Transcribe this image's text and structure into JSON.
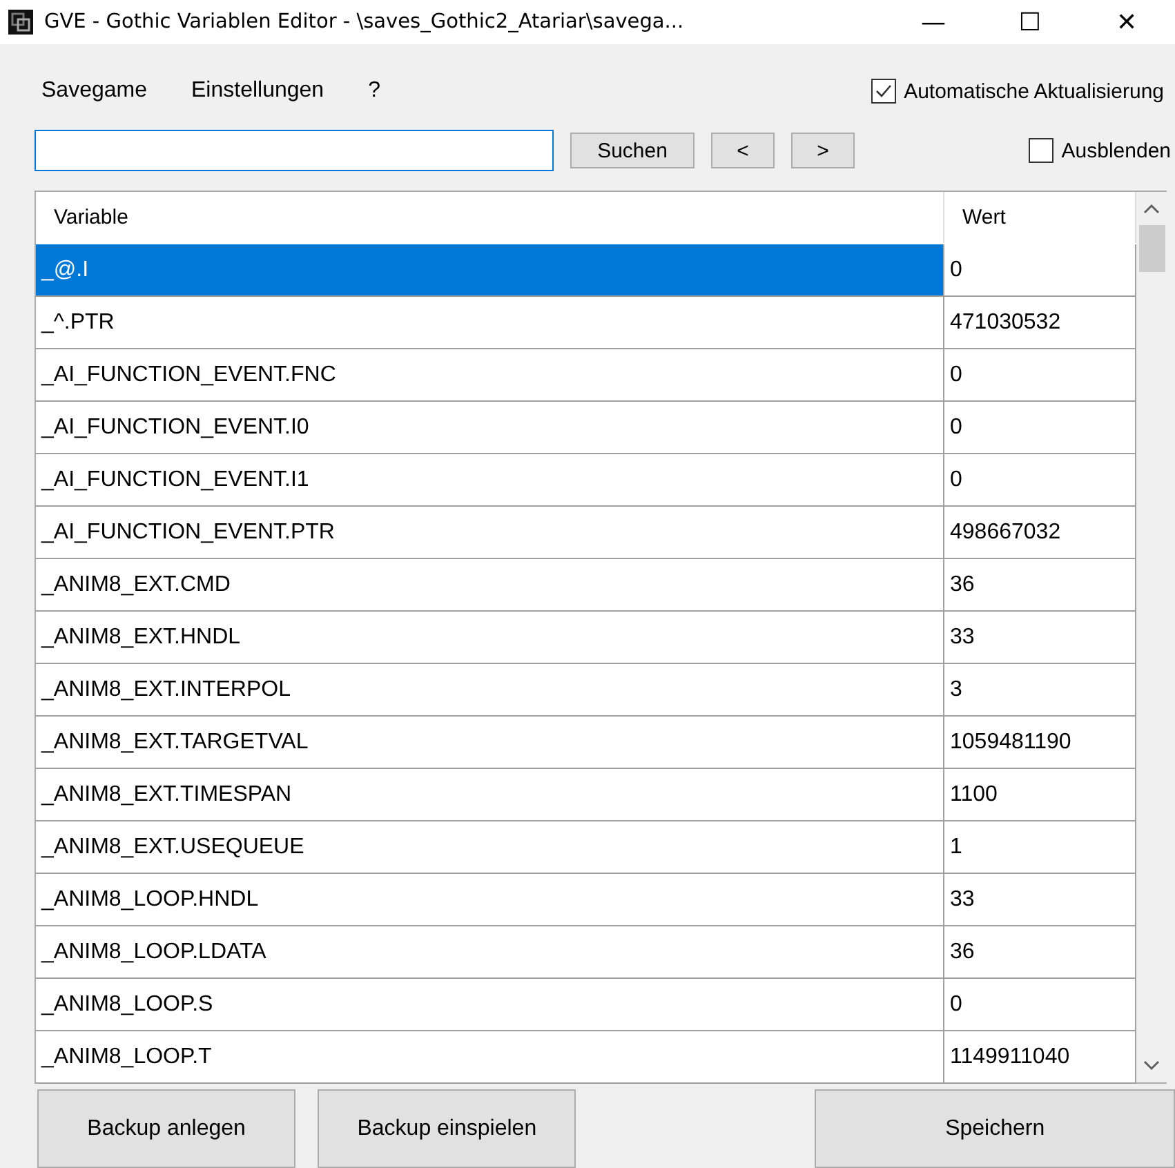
{
  "window": {
    "title": "GVE - Gothic Variablen Editor - \\saves_Gothic2_Atariar\\savega...",
    "controls": [
      "—",
      "☐",
      "✕"
    ]
  },
  "menu": [
    "Savegame",
    "Einstellungen",
    "?"
  ],
  "auto_update": {
    "label": "Automatische Aktualisierung",
    "checked": true
  },
  "search": {
    "button": "Suchen",
    "prev": "<",
    "next": ">"
  },
  "hide": {
    "label": "Ausblenden",
    "checked": false
  },
  "table": {
    "columns": [
      "Variable",
      "Wert"
    ],
    "rows": [
      {
        "variable": "_@.I",
        "value": "0",
        "selected": true
      },
      {
        "variable": "_^.PTR",
        "value": "471030532",
        "selected": false
      },
      {
        "variable": "_AI_FUNCTION_EVENT.FNC",
        "value": "0",
        "selected": false
      },
      {
        "variable": "_AI_FUNCTION_EVENT.I0",
        "value": "0",
        "selected": false
      },
      {
        "variable": "_AI_FUNCTION_EVENT.I1",
        "value": "0",
        "selected": false
      },
      {
        "variable": "_AI_FUNCTION_EVENT.PTR",
        "value": "498667032",
        "selected": false
      },
      {
        "variable": "_ANIM8_EXT.CMD",
        "value": "36",
        "selected": false
      },
      {
        "variable": "_ANIM8_EXT.HNDL",
        "value": "33",
        "selected": false
      },
      {
        "variable": "_ANIM8_EXT.INTERPOL",
        "value": "3",
        "selected": false
      },
      {
        "variable": "_ANIM8_EXT.TARGETVAL",
        "value": "1059481190",
        "selected": false
      },
      {
        "variable": "_ANIM8_EXT.TIMESPAN",
        "value": "1100",
        "selected": false
      },
      {
        "variable": "_ANIM8_EXT.USEQUEUE",
        "value": "1",
        "selected": false
      },
      {
        "variable": "_ANIM8_LOOP.HNDL",
        "value": "33",
        "selected": false
      },
      {
        "variable": "_ANIM8_LOOP.LDATA",
        "value": "36",
        "selected": false
      },
      {
        "variable": "_ANIM8_LOOP.S",
        "value": "0",
        "selected": false
      },
      {
        "variable": "_ANIM8_LOOP.T",
        "value": "1149911040",
        "selected": false
      }
    ]
  },
  "buttons": [
    "Backup anlegen",
    "Backup einspielen",
    "Speichern"
  ]
}
